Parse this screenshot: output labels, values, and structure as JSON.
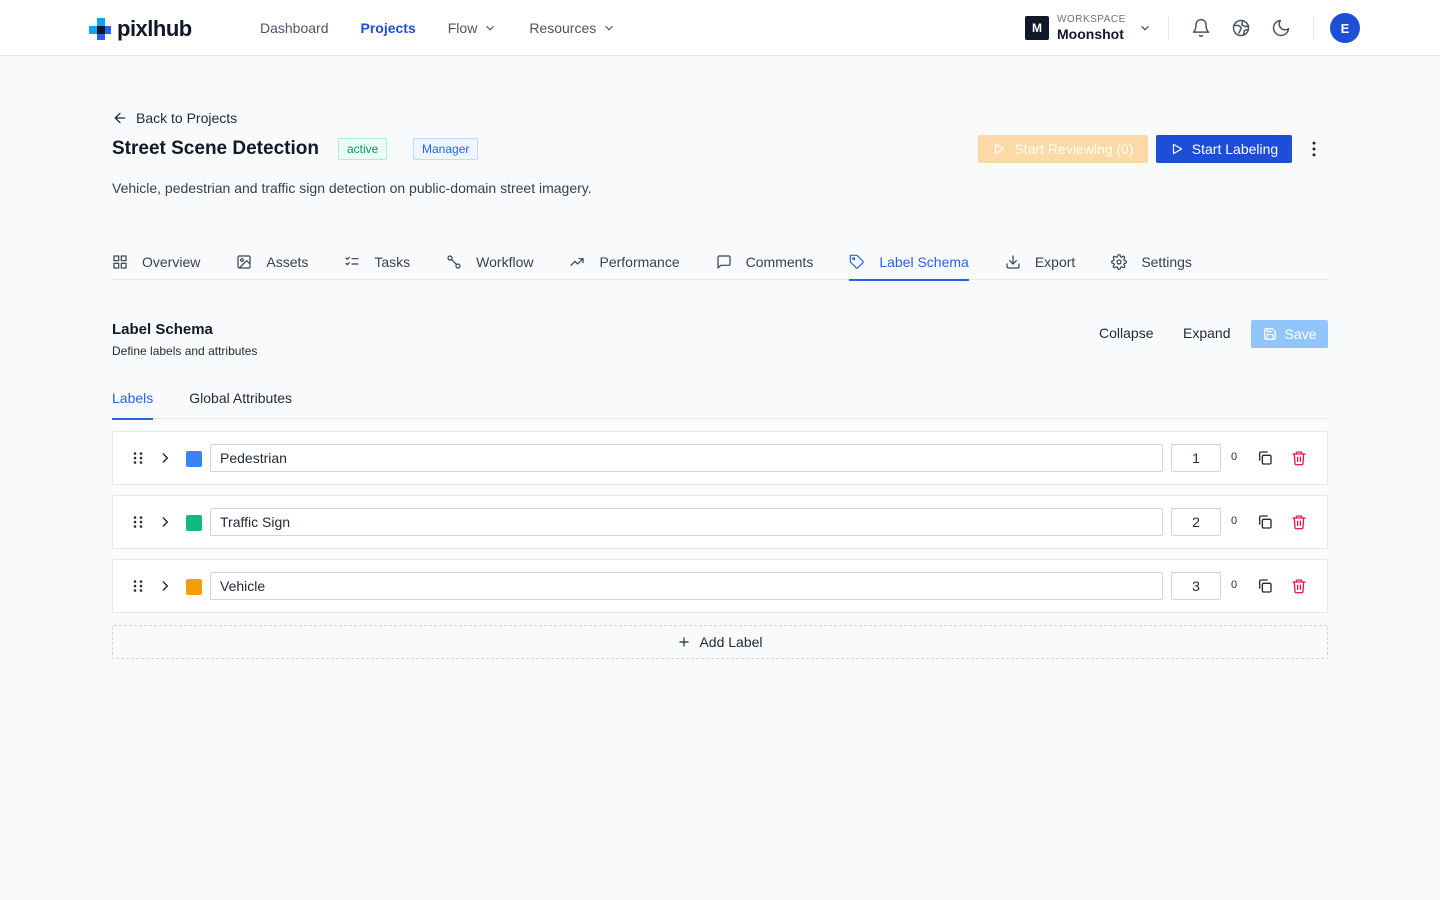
{
  "app": {
    "logo_text": "pixlhub"
  },
  "nav": {
    "items": [
      {
        "label": "Dashboard"
      },
      {
        "label": "Projects"
      },
      {
        "label": "Flow"
      },
      {
        "label": "Resources"
      }
    ]
  },
  "workspace": {
    "badge": "M",
    "caption": "WORKSPACE",
    "name": "Moonshot"
  },
  "user": {
    "initial": "E"
  },
  "header": {
    "back_label": "Back to Projects",
    "title": "Street Scene Detection",
    "status_badge": "active",
    "role_badge": "Manager",
    "review_button": "Start Reviewing (0)",
    "label_button": "Start Labeling",
    "description": "Vehicle, pedestrian and traffic sign detection on public-domain street imagery."
  },
  "tabs": [
    {
      "label": "Overview",
      "icon": "grid-icon"
    },
    {
      "label": "Assets",
      "icon": "image-icon"
    },
    {
      "label": "Tasks",
      "icon": "checklist-icon"
    },
    {
      "label": "Workflow",
      "icon": "workflow-icon"
    },
    {
      "label": "Performance",
      "icon": "trend-icon"
    },
    {
      "label": "Comments",
      "icon": "comment-icon"
    },
    {
      "label": "Label Schema",
      "icon": "tag-icon"
    },
    {
      "label": "Export",
      "icon": "download-icon"
    },
    {
      "label": "Settings",
      "icon": "gear-icon"
    }
  ],
  "active_tab": "Label Schema",
  "schema": {
    "title": "Label Schema",
    "subtitle": "Define labels and attributes",
    "collapse_label": "Collapse",
    "expand_label": "Expand",
    "save_label": "Save",
    "subtabs": [
      {
        "label": "Labels"
      },
      {
        "label": "Global Attributes"
      }
    ],
    "labels": [
      {
        "name": "Pedestrian",
        "id": "1",
        "count": "0",
        "color": "#3b82f6"
      },
      {
        "name": "Traffic Sign",
        "id": "2",
        "count": "0",
        "color": "#10b981"
      },
      {
        "name": "Vehicle",
        "id": "3",
        "count": "0",
        "color": "#f59e0b"
      }
    ],
    "add_label": "Add Label"
  },
  "colors": {
    "primary": "#1d4ed8",
    "accent_blue": "#2563eb",
    "review_disabled": "#fcd9a5",
    "save_disabled": "#93c5fd",
    "danger": "#e11d48"
  }
}
